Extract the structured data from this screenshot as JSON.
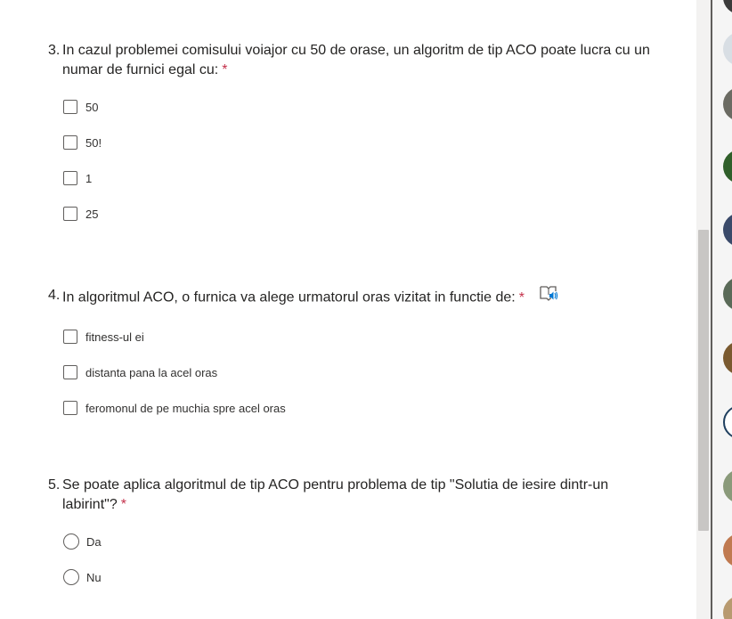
{
  "questions": [
    {
      "number": "3.",
      "text": "In cazul problemei comisului voiajor cu 50 de orase, un algoritm de tip ACO poate lucra cu un numar de furnici egal cu:",
      "required_mark": "*",
      "type": "checkbox",
      "options": [
        "50",
        "50!",
        "1",
        "25"
      ]
    },
    {
      "number": "4.",
      "text": "In algoritmul ACO, o furnica va alege urmatorul oras vizitat in functie de:",
      "required_mark": "*",
      "icon": "immersive-reader-icon",
      "type": "checkbox",
      "options": [
        "fitness-ul ei",
        "distanta pana la acel oras",
        "feromonul de pe muchia spre acel oras"
      ]
    },
    {
      "number": "5.",
      "text": "Se poate aplica algoritmul de tip ACO pentru problema de tip \"Solutia de iesire dintr-un labirint\"?",
      "required_mark": "*",
      "type": "radio",
      "options": [
        "Da",
        "Nu"
      ]
    }
  ],
  "colors": {
    "required": "#c4314b",
    "text": "#252423",
    "control_border": "#605e5c",
    "reader_icon": "#0078d4"
  },
  "side_panel": {
    "avatar_colors": [
      "#3b3b3b",
      "#d8dee4",
      "#6b6b63",
      "#2f5f2a",
      "#3a4a6a",
      "#5a6a58",
      "#7a5a30",
      "#1f3f5f",
      "#8a9a7a",
      "#c07a50",
      "#b89a70"
    ]
  }
}
